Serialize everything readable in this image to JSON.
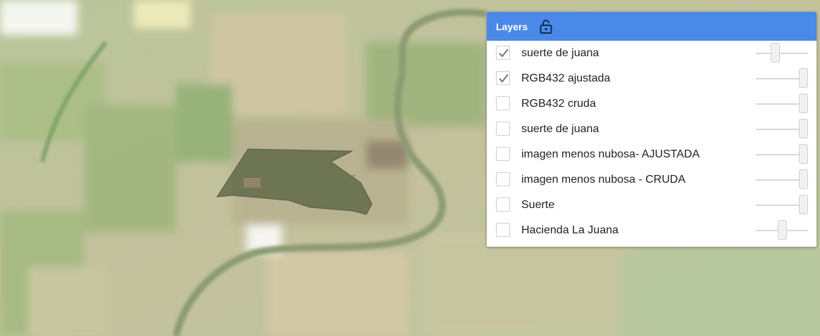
{
  "panel": {
    "title": "Layers",
    "lock_icon": "lock-open-icon",
    "header_color": "#4a89e8"
  },
  "layers": [
    {
      "label": "suerte de juana",
      "checked": true,
      "opacity": 0.35
    },
    {
      "label": "RGB432 ajustada",
      "checked": true,
      "opacity": 1.0
    },
    {
      "label": "RGB432 cruda",
      "checked": false,
      "opacity": 1.0
    },
    {
      "label": "suerte de juana",
      "checked": false,
      "opacity": 1.0
    },
    {
      "label": "imagen menos nubosa- AJUSTADA",
      "checked": false,
      "opacity": 1.0
    },
    {
      "label": "imagen menos nubosa - CRUDA",
      "checked": false,
      "opacity": 1.0
    },
    {
      "label": "Suerte",
      "checked": false,
      "opacity": 1.0
    },
    {
      "label": "Hacienda La Juana",
      "checked": false,
      "opacity": 0.5
    }
  ]
}
